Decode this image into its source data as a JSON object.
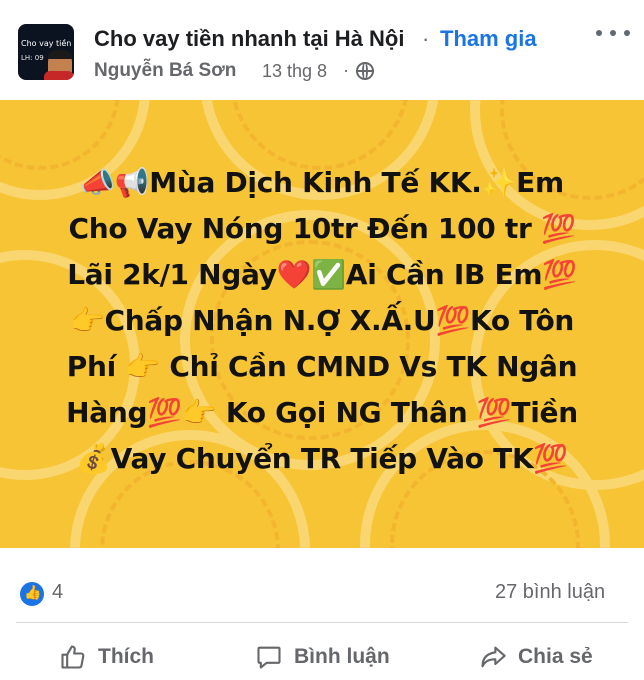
{
  "post": {
    "group_name": "Cho vay tiền nhanh tại Hà Nội",
    "join_label": "Tham gia",
    "author": "Nguyễn Bá Sơn",
    "date": "13 thg 8",
    "separator": "·",
    "avatar": {
      "line1": "Cho vay tiền nhanh",
      "line2": "LH: 09"
    },
    "body_lines": [
      "📣📢Mùa Dịch Kinh Tế KK.✨Em",
      "Cho Vay Nóng 10tr Đến 100 tr 💯",
      "Lãi 2k/1 Ngày❤️✅Ai Cần IB Em💯",
      "👉Chấp Nhận N.Ợ X.Ấ.U💯Ko Tôn",
      "Phí 👉 Chỉ Cần CMND Vs TK Ngân",
      "Hàng💯👉 Ko Gọi NG Thân 💯Tiền",
      "💰Vay Chuyển  TR Tiếp Vào TK💯"
    ],
    "background_color": "#f6c434",
    "reaction_count": "4",
    "comment_count": "27 bình luận"
  },
  "actions": {
    "like": "Thích",
    "comment": "Bình luận",
    "share": "Chia sẻ"
  },
  "colors": {
    "link_blue": "#1b74e4",
    "muted": "#65676b"
  }
}
